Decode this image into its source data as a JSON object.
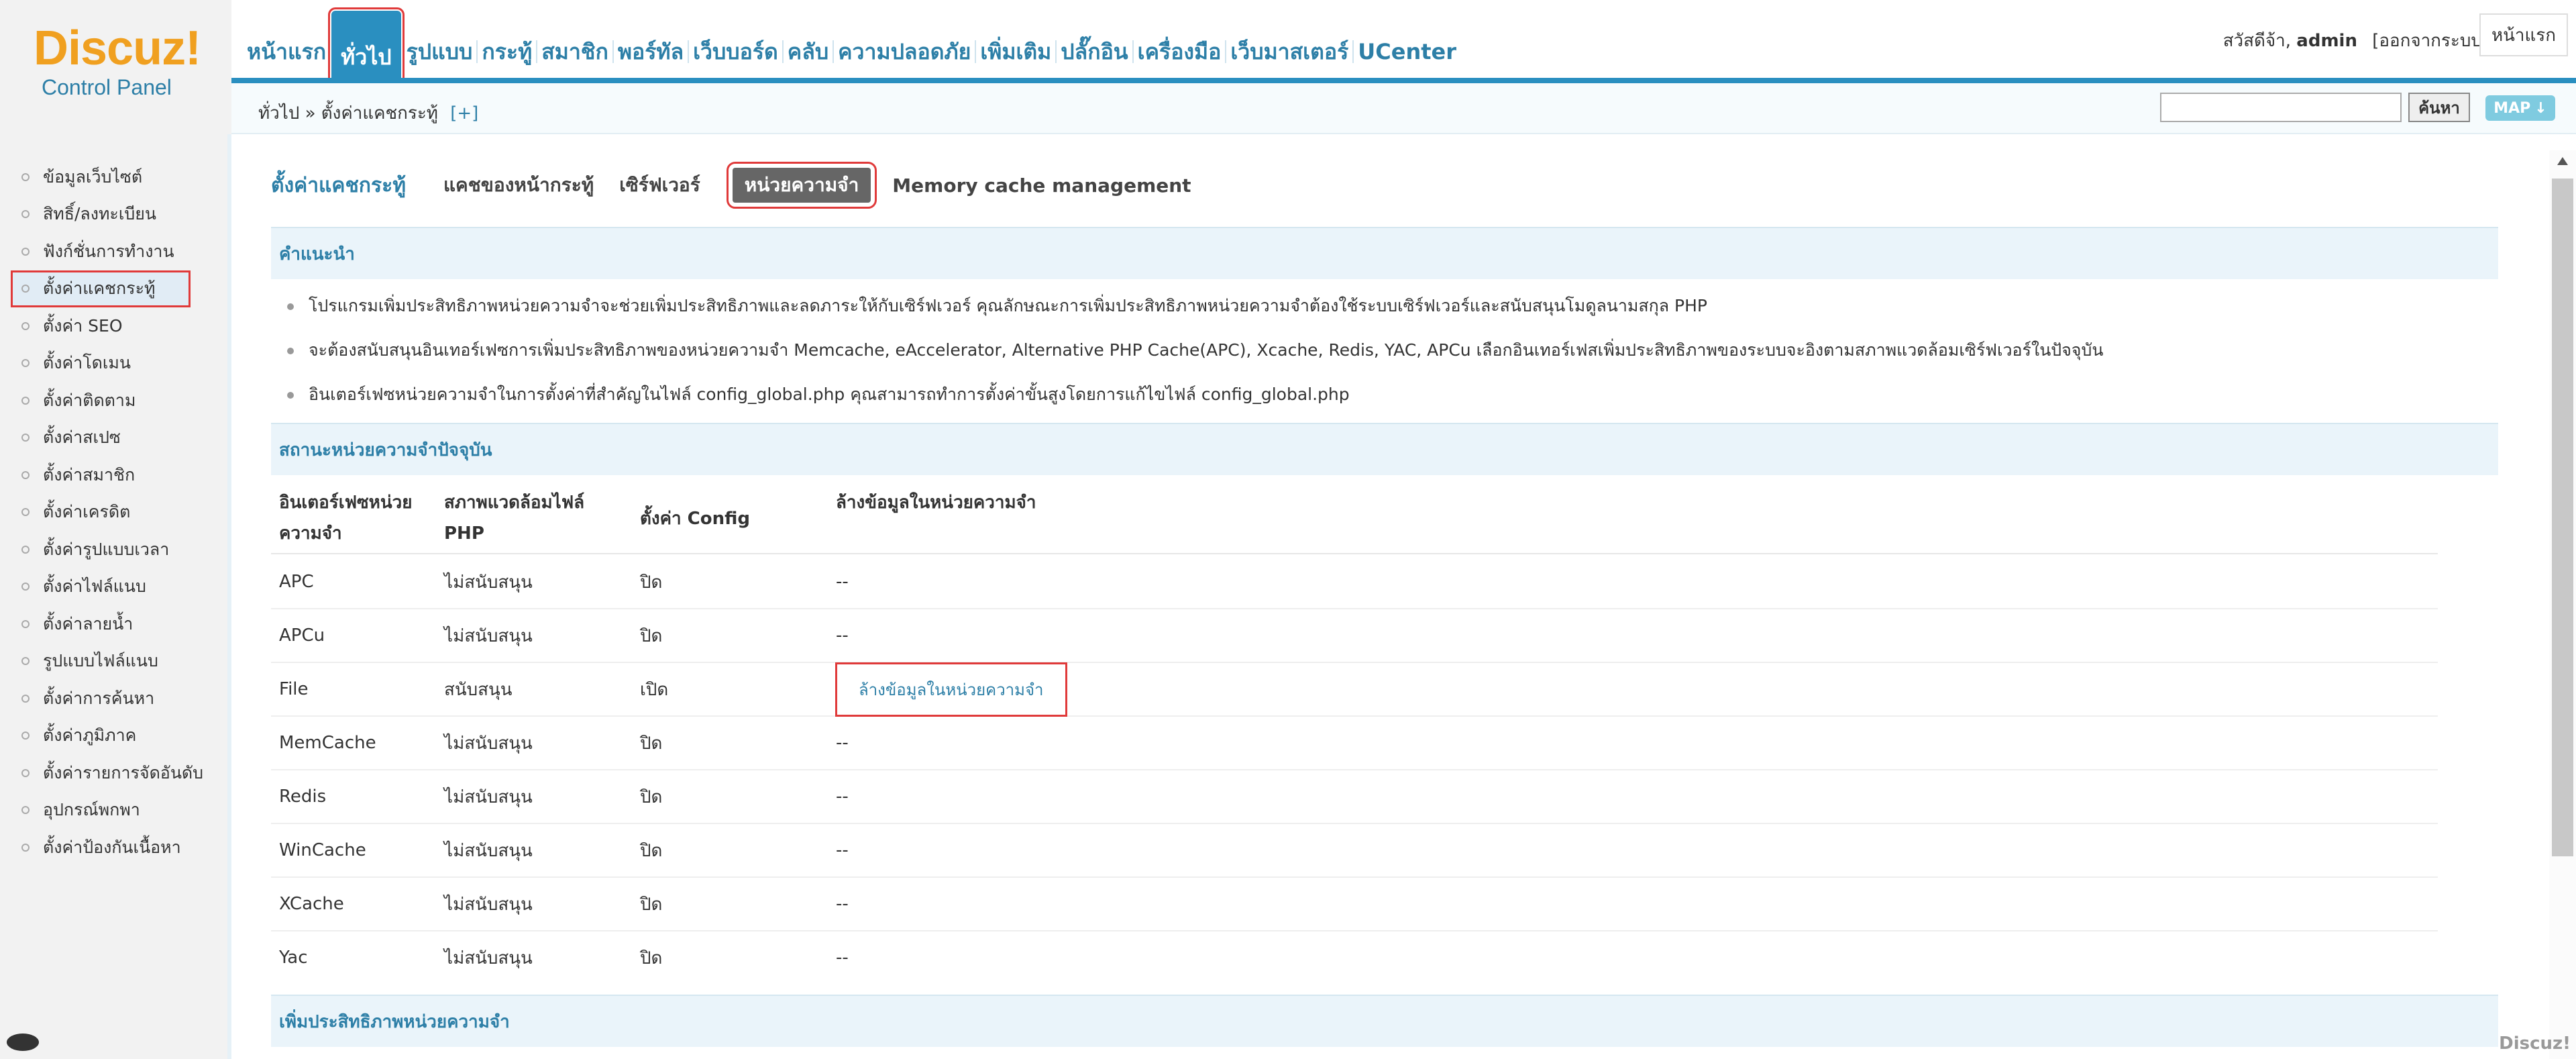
{
  "logo": {
    "brand": "Discuz!",
    "subtitle": "Control Panel"
  },
  "topnav": [
    "หน้าแรก",
    "ทั่วไป",
    "รูปแบบ",
    "กระทู้",
    "สมาชิก",
    "พอร์ทัล",
    "เว็บบอร์ด",
    "คลับ",
    "ความปลอดภัย",
    "เพิ่มเติม",
    "ปลั๊กอิน",
    "เครื่องมือ",
    "เว็บมาสเตอร์",
    "UCenter"
  ],
  "user": {
    "greeting": "สวัสดีจ้า,",
    "name": "admin",
    "logout": "[ออกจากระบบ]",
    "home_button": "หน้าแรก"
  },
  "breadcrumb": {
    "path": "ทั่วไป » ตั้งค่าแคชกระทู้",
    "add": "[+]"
  },
  "search": {
    "value": "",
    "button": "ค้นหา",
    "map": "MAP"
  },
  "sidebar": [
    "ข้อมูลเว็บไซต์",
    "สิทธิ์/ลงทะเบียน",
    "ฟังก์ชั่นการทำงาน",
    "ตั้งค่าแคชกระทู้",
    "ตั้งค่า SEO",
    "ตั้งค่าโดเมน",
    "ตั้งค่าติดตาม",
    "ตั้งค่าสเปซ",
    "ตั้งค่าสมาชิก",
    "ตั้งค่าเครดิต",
    "ตั้งค่ารูปแบบเวลา",
    "ตั้งค่าไฟล์แนบ",
    "ตั้งค่าลายน้ำ",
    "รูปแบบไฟล์แนบ",
    "ตั้งค่าการค้นหา",
    "ตั้งค่าภูมิภาค",
    "ตั้งค่ารายการจัดอันดับ",
    "อุปกรณ์พกพา",
    "ตั้งค่าป้องกันเนื้อหา"
  ],
  "page": {
    "title": "ตั้งค่าแคชกระทู้",
    "tabs": [
      "แคชของหน้ากระทู้",
      "เซิร์ฟเวอร์",
      "หน่วยความจำ",
      "Memory cache management"
    ]
  },
  "tips": {
    "heading": "คำแนะนำ",
    "items": [
      "โปรแกรมเพิ่มประสิทธิภาพหน่วยความจำจะช่วยเพิ่มประสิทธิภาพและลดภาระให้กับเซิร์ฟเวอร์ คุณลักษณะการเพิ่มประสิทธิภาพหน่วยความจำต้องใช้ระบบเซิร์ฟเวอร์และสนับสนุนโมดูลนามสกุล PHP",
      "จะต้องสนับสนุนอินเทอร์เฟซการเพิ่มประสิทธิภาพของหน่วยความจำ Memcache, eAccelerator, Alternative PHP Cache(APC), Xcache, Redis, YAC, APCu เลือกอินเทอร์เฟสเพิ่มประสิทธิภาพของระบบจะอิงตามสภาพแวดล้อมเซิร์ฟเวอร์ในปัจจุบัน",
      "อินเตอร์เฟซหน่วยความจำในการตั้งค่าที่สำคัญในไฟล์ config_global.php คุณสามารถทำการตั้งค่าขั้นสูงโดยการแก้ไขไฟล์ config_global.php"
    ]
  },
  "status": {
    "heading": "สถานะหน่วยความจำปัจจุบัน",
    "columns": [
      "อินเตอร์เฟซหน่วยความจำ",
      "สภาพแวดล้อมไฟล์ PHP",
      "ตั้งค่า Config",
      "ล้างข้อมูลในหน่วยความจำ"
    ],
    "col1_lines": [
      "อินเตอร์เฟซหน่วย",
      "ความจำ"
    ],
    "col2_lines": [
      "สภาพแวดล้อมไฟล์",
      "PHP"
    ],
    "rows": [
      {
        "name": "APC",
        "env": "ไม่สนับสนุน",
        "config": "ปิด",
        "clear": "--"
      },
      {
        "name": "APCu",
        "env": "ไม่สนับสนุน",
        "config": "ปิด",
        "clear": "--"
      },
      {
        "name": "File",
        "env": "สนับสนุน",
        "config": "เปิด",
        "clear": "ล้างข้อมูลในหน่วยความจำ"
      },
      {
        "name": "MemCache",
        "env": "ไม่สนับสนุน",
        "config": "ปิด",
        "clear": "--"
      },
      {
        "name": "Redis",
        "env": "ไม่สนับสนุน",
        "config": "ปิด",
        "clear": "--"
      },
      {
        "name": "WinCache",
        "env": "ไม่สนับสนุน",
        "config": "ปิด",
        "clear": "--"
      },
      {
        "name": "XCache",
        "env": "ไม่สนับสนุน",
        "config": "ปิด",
        "clear": "--"
      },
      {
        "name": "Yac",
        "env": "ไม่สนับสนุน",
        "config": "ปิด",
        "clear": "--"
      }
    ]
  },
  "optimize": {
    "heading": "เพิ่มประสิทธิภาพหน่วยความจำ"
  },
  "watermark": "Discuz!",
  "colors": {
    "accent": "#2a8fc0",
    "link": "#2d7fa7",
    "highlight": "#e03a3a",
    "logo": "#f0a020"
  }
}
